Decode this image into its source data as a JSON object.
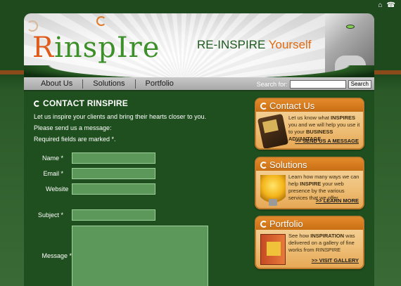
{
  "top_icons": {
    "home_icon": "⌂",
    "phone_icon": "☎"
  },
  "header": {
    "logo_text_r": "R",
    "logo_text_rest": "inspIre",
    "tagline_main": "RE-INSPIRE",
    "tagline_accent": "Yourself"
  },
  "nav": {
    "items": [
      {
        "label": "About Us"
      },
      {
        "label": "Solutions"
      },
      {
        "label": "Portfolio"
      }
    ],
    "search_label": "Search for:",
    "search_value": "",
    "search_button": "Search"
  },
  "contact": {
    "title": "CONTACT RINSPIRE",
    "line1": "Let us inspire your clients and bring their hearts closer to you.",
    "line2": "Please send us a message:",
    "line3": "Required fields are marked *.",
    "fields": {
      "name_label": "Name *",
      "email_label": "Email *",
      "website_label": "Website",
      "subject_label": "Subject *",
      "message_label": "Message *"
    }
  },
  "sidebar": {
    "contact_us": {
      "title": "Contact Us",
      "text_1": "Let us know what ",
      "text_bold_1": "INSPIRES",
      "text_2": " you and we will help you use it to your ",
      "text_bold_2": "BUSINESS ADVANTAGE",
      "text_3": ".",
      "link": ">> SEND US A MESSAGE"
    },
    "solutions": {
      "title": "Solutions",
      "text_1": "Learn how many ways we can help ",
      "text_bold_1": "INSPIRE",
      "text_2": " your web presence by the various services that we offer.",
      "link": ">> LEARN MORE"
    },
    "portfolio": {
      "title": "Portfolio",
      "text_1": "See how ",
      "text_bold_1": "INSPIRATION",
      "text_2": " was delivered on a gallery of fine works from RINSPIRE",
      "link": ">> VISIT GALLERY"
    }
  },
  "colors": {
    "background_green": "#1f4f1f",
    "accent_orange": "#e06a10",
    "field_green": "#5c985a"
  }
}
